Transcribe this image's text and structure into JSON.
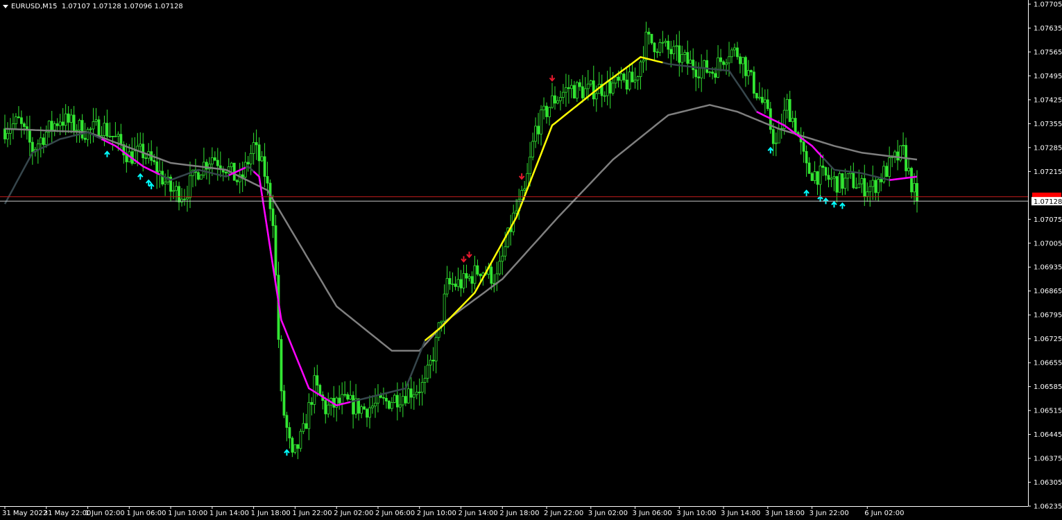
{
  "header": {
    "symbol": "EURUSD,M15",
    "quote": "1.07107 1.07128 1.07096 1.07128"
  },
  "colors": {
    "background": "#000000",
    "axis": "#ffffff",
    "candle": "#32e632",
    "ma_slow": "#7f7f7f",
    "ma_fast": "#36464c",
    "trend_down": "#ff00ff",
    "trend_up": "#ffff00",
    "arrow_up": "#00ffff",
    "arrow_down": "#e6192d",
    "hline_red": "#c81e1e",
    "hline_white": "#c8c8c8",
    "bid_label_bg": "#ffffff",
    "ask_label_bg": "#ff0000"
  },
  "chart_data": {
    "type": "candlestick",
    "symbol": "EURUSD",
    "timeframe": "M15",
    "ylim": [
      1.06235,
      1.07705
    ],
    "y_ticks": [
      "1.07705",
      "1.07635",
      "1.07565",
      "1.07495",
      "1.07425",
      "1.07355",
      "1.07285",
      "1.07215",
      "1.07075",
      "1.07005",
      "1.06935",
      "1.06865",
      "1.06795",
      "1.06725",
      "1.06655",
      "1.06585",
      "1.06515",
      "1.06445",
      "1.06375",
      "1.06305",
      "1.06235"
    ],
    "x_ticks": [
      "31 May 2022",
      "31 May 22:00",
      "1 Jun 02:00",
      "1 Jun 06:00",
      "1 Jun 10:00",
      "1 Jun 14:00",
      "1 Jun 18:00",
      "1 Jun 22:00",
      "2 Jun 02:00",
      "2 Jun 06:00",
      "2 Jun 10:00",
      "2 Jun 14:00",
      "2 Jun 18:00",
      "2 Jun 22:00",
      "3 Jun 02:00",
      "3 Jun 06:00",
      "3 Jun 10:00",
      "3 Jun 14:00",
      "3 Jun 18:00",
      "3 Jun 22:00",
      "6 Jun 02:00"
    ],
    "bid_label": "1.07128",
    "bid_price": 1.07128,
    "ask_price": 1.07141,
    "price_anchors": [
      [
        0,
        1.0734
      ],
      [
        5,
        1.0736
      ],
      [
        10,
        1.0728
      ],
      [
        15,
        1.0733
      ],
      [
        20,
        1.0737
      ],
      [
        25,
        1.0735
      ],
      [
        30,
        1.0733
      ],
      [
        35,
        1.0735
      ],
      [
        40,
        1.0731
      ],
      [
        45,
        1.0726
      ],
      [
        50,
        1.0727
      ],
      [
        55,
        1.0722
      ],
      [
        60,
        1.0716
      ],
      [
        65,
        1.0715
      ],
      [
        70,
        1.0722
      ],
      [
        75,
        1.0726
      ],
      [
        80,
        1.0723
      ],
      [
        85,
        1.0718
      ],
      [
        90,
        1.0729
      ],
      [
        94,
        1.0721
      ],
      [
        97,
        1.0708
      ],
      [
        100,
        1.0655
      ],
      [
        104,
        1.0637
      ],
      [
        108,
        1.0645
      ],
      [
        112,
        1.0659
      ],
      [
        116,
        1.0652
      ],
      [
        122,
        1.0654
      ],
      [
        130,
        1.0652
      ],
      [
        138,
        1.0654
      ],
      [
        146,
        1.0657
      ],
      [
        152,
        1.0659
      ],
      [
        156,
        1.0671
      ],
      [
        160,
        1.0688
      ],
      [
        166,
        1.0689
      ],
      [
        172,
        1.0693
      ],
      [
        178,
        1.069
      ],
      [
        184,
        1.0708
      ],
      [
        188,
        1.0715
      ],
      [
        192,
        1.0734
      ],
      [
        198,
        1.0742
      ],
      [
        204,
        1.0746
      ],
      [
        210,
        1.0745
      ],
      [
        216,
        1.0746
      ],
      [
        222,
        1.0747
      ],
      [
        228,
        1.0748
      ],
      [
        232,
        1.076
      ],
      [
        238,
        1.0758
      ],
      [
        244,
        1.0755
      ],
      [
        250,
        1.0752
      ],
      [
        256,
        1.0751
      ],
      [
        262,
        1.0757
      ],
      [
        266,
        1.0756
      ],
      [
        270,
        1.0748
      ],
      [
        275,
        1.074
      ],
      [
        279,
        1.0729
      ],
      [
        283,
        1.0741
      ],
      [
        286,
        1.0735
      ],
      [
        290,
        1.0722
      ],
      [
        296,
        1.072
      ],
      [
        302,
        1.0718
      ],
      [
        306,
        1.0719
      ],
      [
        310,
        1.0717
      ],
      [
        314,
        1.0717
      ],
      [
        318,
        1.0721
      ],
      [
        322,
        1.0725
      ],
      [
        325,
        1.0727
      ],
      [
        328,
        1.0718
      ],
      [
        330,
        1.07128
      ]
    ],
    "x_tick_bars": [
      0,
      15,
      30,
      45,
      60,
      75,
      90,
      105,
      120,
      135,
      150,
      165,
      180,
      196,
      212,
      228,
      244,
      260,
      276,
      292,
      312
    ],
    "ma_slow_anchors": [
      [
        0,
        1.0734
      ],
      [
        30,
        1.0733
      ],
      [
        60,
        1.0724
      ],
      [
        80,
        1.0722
      ],
      [
        95,
        1.0716
      ],
      [
        120,
        1.0682
      ],
      [
        140,
        1.0669
      ],
      [
        150,
        1.0669
      ],
      [
        160,
        1.0678
      ],
      [
        180,
        1.069
      ],
      [
        200,
        1.0708
      ],
      [
        220,
        1.0725
      ],
      [
        240,
        1.0738
      ],
      [
        255,
        1.0741
      ],
      [
        265,
        1.0739
      ],
      [
        280,
        1.0734
      ],
      [
        300,
        1.0729
      ],
      [
        310,
        1.0727
      ],
      [
        330,
        1.0725
      ]
    ],
    "ma_fast_anchors": [
      [
        0,
        1.0712
      ],
      [
        10,
        1.0727
      ],
      [
        20,
        1.0731
      ],
      [
        30,
        1.0733
      ],
      [
        40,
        1.0729
      ],
      [
        50,
        1.0723
      ],
      [
        60,
        1.0719
      ],
      [
        70,
        1.0722
      ],
      [
        80,
        1.072
      ],
      [
        88,
        1.0723
      ],
      [
        92,
        1.072
      ],
      [
        100,
        1.0678
      ],
      [
        110,
        1.0658
      ],
      [
        120,
        1.0653
      ],
      [
        135,
        1.0656
      ],
      [
        145,
        1.0658
      ],
      [
        152,
        1.0672
      ],
      [
        158,
        1.0676
      ],
      [
        170,
        1.0686
      ],
      [
        185,
        1.0708
      ],
      [
        198,
        1.0735
      ],
      [
        215,
        1.0746
      ],
      [
        230,
        1.0755
      ],
      [
        240,
        1.0753
      ],
      [
        250,
        1.0752
      ],
      [
        262,
        1.0751
      ],
      [
        272,
        1.0739
      ],
      [
        282,
        1.0735
      ],
      [
        292,
        1.0729
      ],
      [
        300,
        1.0722
      ],
      [
        310,
        1.0721
      ],
      [
        320,
        1.0719
      ],
      [
        330,
        1.072
      ]
    ],
    "trend_segments": [
      {
        "trend": "down",
        "from": 35,
        "to": 56
      },
      {
        "trend": "down",
        "from": 81,
        "to": 87
      },
      {
        "trend": "down",
        "from": 90,
        "to": 125
      },
      {
        "trend": "up",
        "from": 152,
        "to": 238
      },
      {
        "trend": "down",
        "from": 272,
        "to": 296
      },
      {
        "trend": "down",
        "from": 320,
        "to": 330
      }
    ],
    "arrows": [
      {
        "dir": "up",
        "bar": 37
      },
      {
        "dir": "up",
        "bar": 49
      },
      {
        "dir": "up",
        "bar": 52
      },
      {
        "dir": "up",
        "bar": 53
      },
      {
        "dir": "up",
        "bar": 102
      },
      {
        "dir": "down",
        "bar": 166
      },
      {
        "dir": "down",
        "bar": 168
      },
      {
        "dir": "down",
        "bar": 187
      },
      {
        "dir": "down",
        "bar": 198
      },
      {
        "dir": "up",
        "bar": 277
      },
      {
        "dir": "up",
        "bar": 290
      },
      {
        "dir": "up",
        "bar": 295
      },
      {
        "dir": "up",
        "bar": 297
      },
      {
        "dir": "up",
        "bar": 300
      },
      {
        "dir": "up",
        "bar": 303
      }
    ],
    "grid": false,
    "legend": "none"
  }
}
